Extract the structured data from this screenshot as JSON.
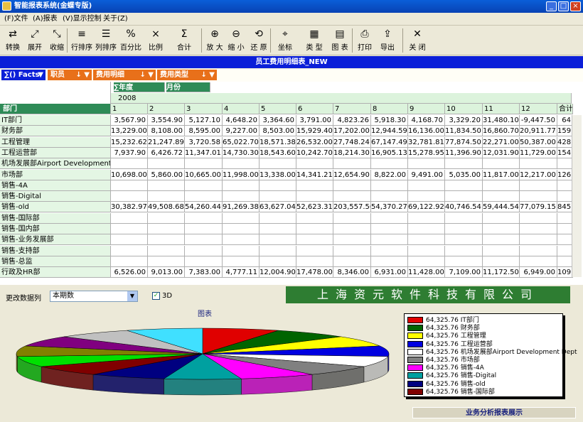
{
  "window": {
    "title": "智能报表系统(金蝶专版)",
    "min": "_",
    "max": "□",
    "close": "×"
  },
  "menu": [
    "(F)文件",
    "(A)报表",
    "(V)显示控制",
    "关于(Z)"
  ],
  "toolbar": [
    "转换",
    "展开",
    "收缩",
    "行排序",
    "列排序",
    "百分比",
    "比例",
    "合计",
    "放 大",
    "缩 小",
    "还 原",
    "坐标",
    "类 型",
    "图 表",
    "打印",
    "导出",
    "关 闭"
  ],
  "toolbar_icons": [
    "convert-icon",
    "expand-icon",
    "collapse-icon",
    "row-sort-icon",
    "col-sort-icon",
    "percent-icon",
    "ratio-icon",
    "sum-icon",
    "zoom-in-icon",
    "zoom-out-icon",
    "restore-icon",
    "axis-icon",
    "type-icon",
    "chart-icon",
    "print-icon",
    "export-icon",
    "close-icon"
  ],
  "report_title": "员工费用明细表_NEW",
  "filters": {
    "facts": "∑() Facts",
    "f1": "职员",
    "f2": "费用明细",
    "f3": "费用类型",
    "year": "∑年度",
    "month": "月份",
    "year_value": "2008",
    "dept_header": "部门"
  },
  "columns": [
    "1",
    "2",
    "3",
    "4",
    "5",
    "6",
    "7",
    "8",
    "9",
    "10",
    "11",
    "12",
    "合计"
  ],
  "rows": [
    {
      "dept": "IT部门",
      "values": [
        "3,567.90",
        "3,554.90",
        "5,127.10",
        "4,648.20",
        "3,364.60",
        "3,791.00",
        "4,823.26",
        "5,918.30",
        "4,168.70",
        "3,329.20",
        "31,480.10",
        "-9,447.50",
        "64"
      ]
    },
    {
      "dept": "财务部",
      "values": [
        "13,229.00",
        "8,108.00",
        "8,595.00",
        "9,227.00",
        "8,503.00",
        "15,929.40",
        "17,202.00",
        "12,944.59",
        "16,136.00",
        "11,834.50",
        "16,860.70",
        "20,911.77",
        "159,"
      ]
    },
    {
      "dept": "工程管理",
      "values": [
        "15,232.62",
        "21,247.89",
        "3,720.58",
        "65,022.70",
        "18,571.38",
        "26,532.00",
        "27,748.24",
        "67,147.49",
        "32,781.81",
        "77,874.50",
        "22,271.00",
        "50,387.00",
        "428,"
      ]
    },
    {
      "dept": "工程运营部",
      "values": [
        "7,937.90",
        "6,426.72",
        "11,347.01",
        "14,730.30",
        "18,543.60",
        "10,242.70",
        "18,214.30",
        "16,905.13",
        "15,278.95",
        "11,396.90",
        "12,031.90",
        "11,729.00",
        "154,"
      ]
    },
    {
      "dept": "机场发展部Airport Development Dept",
      "values": [
        "",
        "",
        "",
        "",
        "",
        "",
        "",
        "",
        "",
        "",
        "",
        "",
        ""
      ]
    },
    {
      "dept": "市场部",
      "values": [
        "10,698.00",
        "5,860.00",
        "10,665.00",
        "11,998.00",
        "13,338.00",
        "14,341.21",
        "12,654.90",
        "8,822.00",
        "9,491.00",
        "5,035.00",
        "11,817.00",
        "12,217.00",
        "126,"
      ]
    },
    {
      "dept": "销售-4A",
      "values": [
        "",
        "",
        "",
        "",
        "",
        "",
        "",
        "",
        "",
        "",
        "",
        "",
        ""
      ]
    },
    {
      "dept": "销售-Digital",
      "values": [
        "",
        "",
        "",
        "",
        "",
        "",
        "",
        "",
        "",
        "",
        "",
        "",
        ""
      ]
    },
    {
      "dept": "销售-old",
      "values": [
        "30,382.97",
        "49,508.68",
        "54,260.44",
        "91,269.38",
        "63,627.04",
        "52,623.31",
        "203,557.56",
        "54,370.27",
        "69,122.92",
        "40,746.54",
        "59,444.54",
        "77,079.15",
        "845,"
      ]
    },
    {
      "dept": "销售-国际部",
      "values": [
        "",
        "",
        "",
        "",
        "",
        "",
        "",
        "",
        "",
        "",
        "",
        "",
        ""
      ]
    },
    {
      "dept": "销售-国内部",
      "values": [
        "",
        "",
        "",
        "",
        "",
        "",
        "",
        "",
        "",
        "",
        "",
        "",
        ""
      ]
    },
    {
      "dept": "销售-业务发展部",
      "values": [
        "",
        "",
        "",
        "",
        "",
        "",
        "",
        "",
        "",
        "",
        "",
        "",
        ""
      ]
    },
    {
      "dept": "销售-支持部",
      "values": [
        "",
        "",
        "",
        "",
        "",
        "",
        "",
        "",
        "",
        "",
        "",
        "",
        ""
      ]
    },
    {
      "dept": "销售-总监",
      "values": [
        "",
        "",
        "",
        "",
        "",
        "",
        "",
        "",
        "",
        "",
        "",
        "",
        ""
      ]
    },
    {
      "dept": "行政及HR部",
      "values": [
        "6,526.00",
        "9,013.00",
        "7,383.00",
        "4,777.11",
        "12,004.90",
        "17,478.00",
        "8,346.00",
        "6,931.00",
        "11,428.00",
        "7,109.00",
        "11,172.50",
        "6,949.00",
        "109,"
      ]
    }
  ],
  "bottom": {
    "change_label": "更改数据列",
    "select_value": "本期数",
    "checkbox_label": "3D",
    "company": "上海资元软件科技有限公司",
    "chart_title": "图表",
    "status": "业务分析报表展示"
  },
  "colors": {
    "title_blue": "#0b1fd8",
    "pill_orange": "#e8701a",
    "grid_green": "#dcf3dc",
    "banner_green": "#2e7d32"
  },
  "chart_data": {
    "type": "pie",
    "title": "图表",
    "three_d": true,
    "categories": [
      "IT部门",
      "财务部",
      "工程管理",
      "工程运营部",
      "机场发展部Airport Development Dept",
      "市场部",
      "销售-4A",
      "销售-Digital",
      "销售-old",
      "销售-国际部"
    ],
    "values": [
      64325.76,
      64325.76,
      64325.76,
      64325.76,
      64325.76,
      64325.76,
      64325.76,
      64325.76,
      64325.76,
      64325.76
    ],
    "value_labels": [
      "64,325.76",
      "64,325.76",
      "64,325.76",
      "64,325.76",
      "64,325.76",
      "64,325.76",
      "64,325.76",
      "64,325.76",
      "64,325.76",
      "64,325.76"
    ],
    "colors": [
      "#e00000",
      "#006400",
      "#ffff00",
      "#0000e0",
      "#ffffff",
      "#808080",
      "#ff00ff",
      "#00a0a0",
      "#000080",
      "#800000",
      "#00e000",
      "#808000",
      "#800080",
      "#c0c0c0",
      "#40e0ff"
    ],
    "legend": "right"
  }
}
